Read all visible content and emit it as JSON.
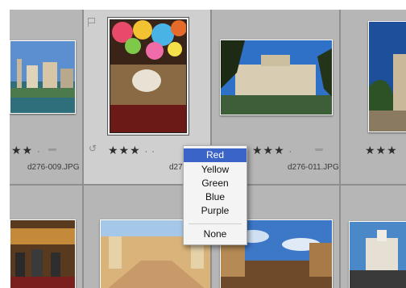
{
  "row1": [
    {
      "rating": "★★",
      "dots": "·",
      "filename": "d276-009.JPG"
    },
    {
      "rating": "★★★",
      "dots": "· ·",
      "filename": "d276"
    },
    {
      "rating": "★★★",
      "dots": "·",
      "filename": "d276-011.JPG"
    },
    {
      "rating": "★★★",
      "dots": "",
      "filename": ""
    }
  ],
  "menu": {
    "items": [
      "Red",
      "Yellow",
      "Green",
      "Blue",
      "Purple"
    ],
    "none_label": "None",
    "highlighted": "Red"
  },
  "colors": {
    "menu_highlight": "#3b64c9",
    "grid_bg": "#7a7a7a",
    "cell_bg": "#b6b6b6"
  }
}
